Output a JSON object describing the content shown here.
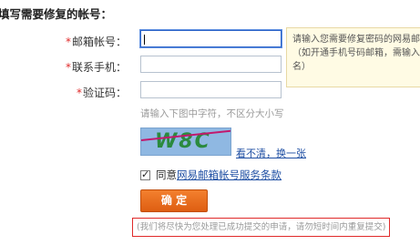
{
  "section_title": "填写需要修复的帐号：",
  "form": {
    "email": {
      "label": "邮箱帐号：",
      "required_mark": "*",
      "value": ""
    },
    "phone": {
      "label": "联系手机：",
      "required_mark": "*",
      "value": ""
    },
    "captcha": {
      "label": "验证码：",
      "required_mark": "*",
      "value": ""
    }
  },
  "tip": {
    "line1": "请输入您需要修复密码的网易邮箱帐",
    "line2": "（如开通手机号码邮箱，需输入主帐",
    "line3": "名）"
  },
  "captcha_hint": "请输入下图中字符，不区分大小写",
  "captcha_image_text": "W8C",
  "refresh_link": "看不清，换一张",
  "agreement": {
    "checked": true,
    "prefix": "同意",
    "link": "网易邮箱帐号服务条款"
  },
  "confirm_button": "确 定",
  "notice": "(我们将尽快为您处理已成功提交的申请，请勿短时间内重复提交)"
}
